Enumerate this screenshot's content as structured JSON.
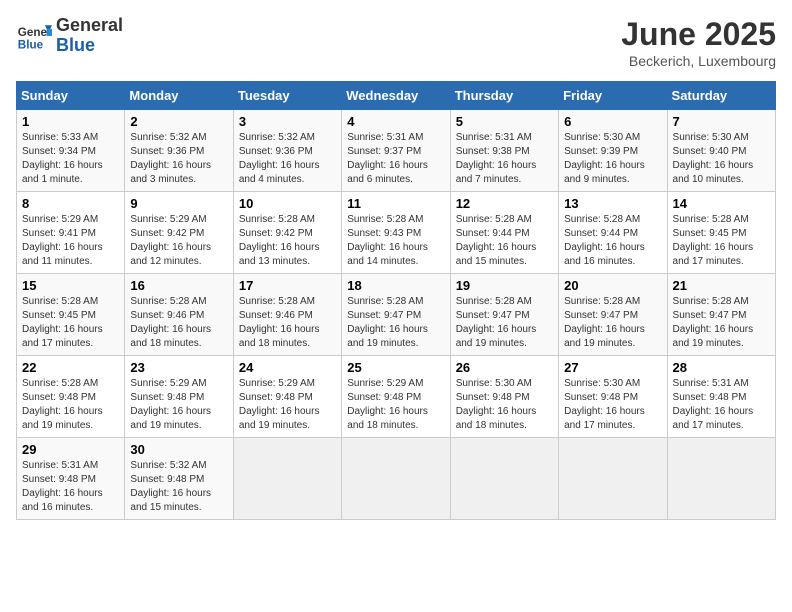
{
  "header": {
    "logo_general": "General",
    "logo_blue": "Blue",
    "month_title": "June 2025",
    "location": "Beckerich, Luxembourg"
  },
  "days_of_week": [
    "Sunday",
    "Monday",
    "Tuesday",
    "Wednesday",
    "Thursday",
    "Friday",
    "Saturday"
  ],
  "weeks": [
    [
      {
        "day": "1",
        "info": "Sunrise: 5:33 AM\nSunset: 9:34 PM\nDaylight: 16 hours and 1 minute."
      },
      {
        "day": "2",
        "info": "Sunrise: 5:32 AM\nSunset: 9:36 PM\nDaylight: 16 hours and 3 minutes."
      },
      {
        "day": "3",
        "info": "Sunrise: 5:32 AM\nSunset: 9:36 PM\nDaylight: 16 hours and 4 minutes."
      },
      {
        "day": "4",
        "info": "Sunrise: 5:31 AM\nSunset: 9:37 PM\nDaylight: 16 hours and 6 minutes."
      },
      {
        "day": "5",
        "info": "Sunrise: 5:31 AM\nSunset: 9:38 PM\nDaylight: 16 hours and 7 minutes."
      },
      {
        "day": "6",
        "info": "Sunrise: 5:30 AM\nSunset: 9:39 PM\nDaylight: 16 hours and 9 minutes."
      },
      {
        "day": "7",
        "info": "Sunrise: 5:30 AM\nSunset: 9:40 PM\nDaylight: 16 hours and 10 minutes."
      }
    ],
    [
      {
        "day": "8",
        "info": "Sunrise: 5:29 AM\nSunset: 9:41 PM\nDaylight: 16 hours and 11 minutes."
      },
      {
        "day": "9",
        "info": "Sunrise: 5:29 AM\nSunset: 9:42 PM\nDaylight: 16 hours and 12 minutes."
      },
      {
        "day": "10",
        "info": "Sunrise: 5:28 AM\nSunset: 9:42 PM\nDaylight: 16 hours and 13 minutes."
      },
      {
        "day": "11",
        "info": "Sunrise: 5:28 AM\nSunset: 9:43 PM\nDaylight: 16 hours and 14 minutes."
      },
      {
        "day": "12",
        "info": "Sunrise: 5:28 AM\nSunset: 9:44 PM\nDaylight: 16 hours and 15 minutes."
      },
      {
        "day": "13",
        "info": "Sunrise: 5:28 AM\nSunset: 9:44 PM\nDaylight: 16 hours and 16 minutes."
      },
      {
        "day": "14",
        "info": "Sunrise: 5:28 AM\nSunset: 9:45 PM\nDaylight: 16 hours and 17 minutes."
      }
    ],
    [
      {
        "day": "15",
        "info": "Sunrise: 5:28 AM\nSunset: 9:45 PM\nDaylight: 16 hours and 17 minutes."
      },
      {
        "day": "16",
        "info": "Sunrise: 5:28 AM\nSunset: 9:46 PM\nDaylight: 16 hours and 18 minutes."
      },
      {
        "day": "17",
        "info": "Sunrise: 5:28 AM\nSunset: 9:46 PM\nDaylight: 16 hours and 18 minutes."
      },
      {
        "day": "18",
        "info": "Sunrise: 5:28 AM\nSunset: 9:47 PM\nDaylight: 16 hours and 19 minutes."
      },
      {
        "day": "19",
        "info": "Sunrise: 5:28 AM\nSunset: 9:47 PM\nDaylight: 16 hours and 19 minutes."
      },
      {
        "day": "20",
        "info": "Sunrise: 5:28 AM\nSunset: 9:47 PM\nDaylight: 16 hours and 19 minutes."
      },
      {
        "day": "21",
        "info": "Sunrise: 5:28 AM\nSunset: 9:47 PM\nDaylight: 16 hours and 19 minutes."
      }
    ],
    [
      {
        "day": "22",
        "info": "Sunrise: 5:28 AM\nSunset: 9:48 PM\nDaylight: 16 hours and 19 minutes."
      },
      {
        "day": "23",
        "info": "Sunrise: 5:29 AM\nSunset: 9:48 PM\nDaylight: 16 hours and 19 minutes."
      },
      {
        "day": "24",
        "info": "Sunrise: 5:29 AM\nSunset: 9:48 PM\nDaylight: 16 hours and 19 minutes."
      },
      {
        "day": "25",
        "info": "Sunrise: 5:29 AM\nSunset: 9:48 PM\nDaylight: 16 hours and 18 minutes."
      },
      {
        "day": "26",
        "info": "Sunrise: 5:30 AM\nSunset: 9:48 PM\nDaylight: 16 hours and 18 minutes."
      },
      {
        "day": "27",
        "info": "Sunrise: 5:30 AM\nSunset: 9:48 PM\nDaylight: 16 hours and 17 minutes."
      },
      {
        "day": "28",
        "info": "Sunrise: 5:31 AM\nSunset: 9:48 PM\nDaylight: 16 hours and 17 minutes."
      }
    ],
    [
      {
        "day": "29",
        "info": "Sunrise: 5:31 AM\nSunset: 9:48 PM\nDaylight: 16 hours and 16 minutes."
      },
      {
        "day": "30",
        "info": "Sunrise: 5:32 AM\nSunset: 9:48 PM\nDaylight: 16 hours and 15 minutes."
      },
      null,
      null,
      null,
      null,
      null
    ]
  ]
}
